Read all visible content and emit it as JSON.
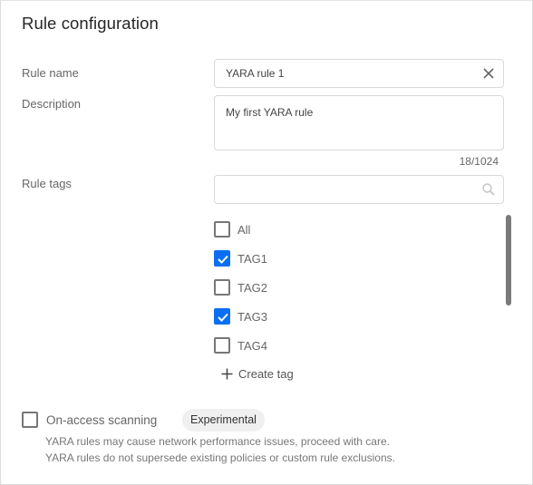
{
  "title": "Rule configuration",
  "fields": {
    "rule_name": {
      "label": "Rule name",
      "value": "YARA rule 1"
    },
    "description": {
      "label": "Description",
      "value": "My first YARA rule",
      "counter": "18/1024"
    },
    "rule_tags": {
      "label": "Rule tags",
      "search_value": ""
    }
  },
  "tags": [
    {
      "label": "All",
      "checked": false
    },
    {
      "label": "TAG1",
      "checked": true
    },
    {
      "label": "TAG2",
      "checked": false
    },
    {
      "label": "TAG3",
      "checked": true
    },
    {
      "label": "TAG4",
      "checked": false
    }
  ],
  "create_tag_label": "Create tag",
  "on_access": {
    "label": "On-access scanning",
    "checked": false,
    "badge": "Experimental",
    "notes": [
      "YARA rules may cause network performance issues, proceed with care.",
      "YARA rules do not supersede existing policies or custom rule exclusions."
    ]
  },
  "colors": {
    "accent": "#0a6ff2"
  }
}
